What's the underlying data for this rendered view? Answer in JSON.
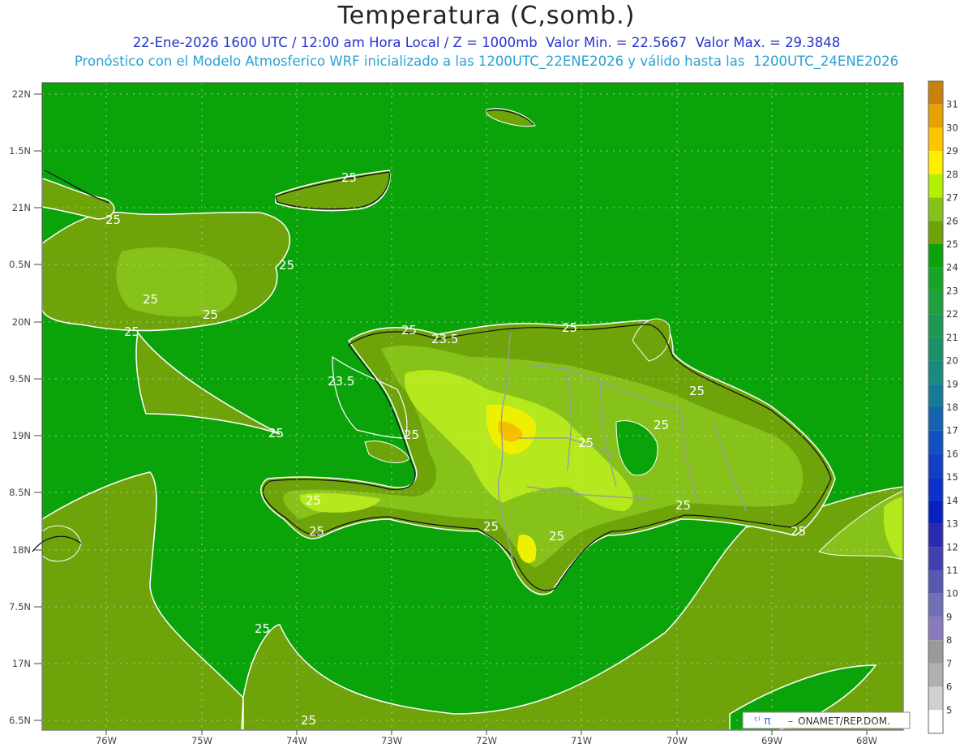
{
  "header": {
    "title": "Temperatura (C,somb.)",
    "line1": "22-Ene-2026 1600 UTC / 12:00 am Hora Local / Z = 1000mb  Valor Min. = 22.5667  Valor Max. = 29.3848",
    "line2": "Pronóstico con el Modelo Atmosferico WRF inicializado a las 1200UTC_22ENE2026 y válido hasta las  1200UTC_24ENE2026"
  },
  "map": {
    "lat_ticks": [
      "22N",
      "1.5N",
      "21N",
      "0.5N",
      "20N",
      "9.5N",
      "19N",
      "8.5N",
      "18N",
      "7.5N",
      "17N",
      "6.5N"
    ],
    "lon_ticks": [
      "76W",
      "75W",
      "74W",
      "73W",
      "72W",
      "71W",
      "70W",
      "69W",
      "68W"
    ],
    "contour_labels": [
      {
        "text": "25",
        "id": "c1"
      },
      {
        "text": "25",
        "id": "c2"
      },
      {
        "text": "25",
        "id": "c3"
      },
      {
        "text": "25",
        "id": "c4"
      },
      {
        "text": "25",
        "id": "c5"
      },
      {
        "text": "25",
        "id": "c6"
      },
      {
        "text": "25",
        "id": "c7"
      },
      {
        "text": "23.5",
        "id": "c8"
      },
      {
        "text": "25",
        "id": "c9"
      },
      {
        "text": "23.5",
        "id": "c10"
      },
      {
        "text": "25",
        "id": "c11"
      },
      {
        "text": "25",
        "id": "c12"
      },
      {
        "text": "25",
        "id": "c13"
      },
      {
        "text": "25",
        "id": "c14"
      },
      {
        "text": "25",
        "id": "c15"
      },
      {
        "text": "25",
        "id": "c16"
      },
      {
        "text": "25",
        "id": "c17"
      },
      {
        "text": "25",
        "id": "c18"
      },
      {
        "text": "25",
        "id": "c19"
      },
      {
        "text": "25",
        "id": "c20"
      },
      {
        "text": "25",
        "id": "c21"
      },
      {
        "text": "25",
        "id": "c22"
      }
    ],
    "colors": {
      "sea": "#0aa40a",
      "t25_26": "#6ea30a",
      "t26_27": "#86c21a",
      "t27_28": "#b6e81e",
      "t28_29": "#eef000",
      "t29_30": "#f6be00",
      "contour": "#ffffff",
      "border": "#9c9c9c",
      "coast": "#111111"
    }
  },
  "colorbar": {
    "levels": [
      "31",
      "30",
      "29",
      "28",
      "27",
      "26",
      "25",
      "24",
      "23",
      "22",
      "21",
      "20",
      "19",
      "18",
      "17",
      "16",
      "15",
      "14",
      "13",
      "12",
      "11",
      "10",
      "9",
      "8",
      "7",
      "6",
      "5"
    ],
    "colors": [
      "#c8820a",
      "#e7a100",
      "#ffc600",
      "#ffee00",
      "#b0f000",
      "#86c21a",
      "#6ea30a",
      "#0aa40a",
      "#15a529",
      "#20a03e",
      "#1e9852",
      "#1e9068",
      "#1a8a80",
      "#167a98",
      "#1662b2",
      "#1350c0",
      "#1040c4",
      "#0c30c8",
      "#0820c0",
      "#2a2ab0",
      "#4040b0",
      "#5858b2",
      "#7070b4",
      "#8a7cbc",
      "#9a9a9a",
      "#b0b0b0",
      "#d0d0d0",
      "#ffffff"
    ]
  },
  "credit": {
    "text": "ONAMET/REP.DOM."
  }
}
